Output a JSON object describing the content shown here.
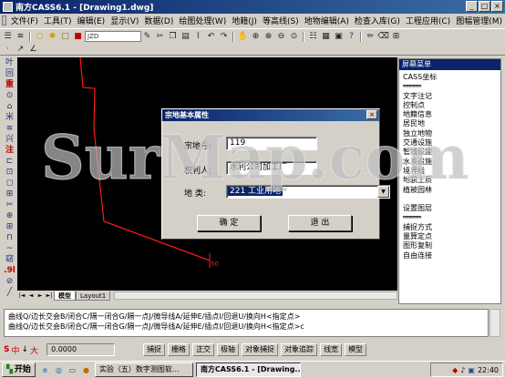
{
  "window": {
    "title": "南方CASS6.1 - [Drawing1.dwg]",
    "controls": [
      "_",
      "□",
      "×"
    ]
  },
  "menu": [
    "文件(F)",
    "工具(T)",
    "编辑(E)",
    "显示(V)",
    "数据(D)",
    "绘图处理(W)",
    "地籍(J)",
    "等高线(S)",
    "地物编辑(A)",
    "检查入库(G)",
    "工程应用(C)",
    "图幅管理(M)"
  ],
  "toolbar": {
    "layer_value": "JZD"
  },
  "left_tools": [
    "叶",
    "回",
    "重",
    "⊙",
    "⌂",
    "米",
    "≡",
    "兴",
    "注",
    "⊏",
    "⊡",
    "◻",
    "⊞",
    "✂",
    "⊕",
    "⊞",
    "⊓",
    "~",
    "窈",
    ".9l",
    "⊘",
    "╱"
  ],
  "screen_menu": {
    "title": "屏幕菜单",
    "items": [
      "CASS坐标",
      "═════",
      "文字注记",
      "控制点",
      "地籍信息",
      "居民地",
      "独立地物",
      "交通设施",
      "管线设施",
      "水系设施",
      "境界线",
      "地貌土质",
      "植被园林",
      "",
      "设置图层",
      "═════",
      "捕捉方式",
      "量算定点",
      "图形复制",
      "自由连接"
    ]
  },
  "canvas": {
    "vertex_label": "50"
  },
  "tabs": {
    "nav": [
      "|◄",
      "◄",
      "►",
      "►|"
    ],
    "items": [
      "模型",
      "Layout1"
    ]
  },
  "command": {
    "lines": [
      "曲线Q/边长交会B/闭合C/隔一闭合G/隔一点J/微导线A/延伸E/插点I/回退U/换向H<指定点>",
      "曲线Q/边长交会B/闭合C/隔一闭合G/隔一点J/微导线A/延伸E/插点I/回退U/换向H<指定点>c"
    ]
  },
  "status": {
    "ime": [
      "中",
      "↓",
      "大"
    ],
    "coords": "0.0000",
    "buttons": [
      "捕捉",
      "栅格",
      "正交",
      "极轴",
      "对象捕捉",
      "对象追踪",
      "线宽",
      "模型"
    ]
  },
  "taskbar": {
    "start": "开始",
    "tasks": [
      "实验（五）数字测图软...",
      "南方CASS6.1 - [Drawing..."
    ],
    "clock": "22:40"
  },
  "dialog": {
    "title": "宗地基本属性",
    "close": "×",
    "parcel_no_label": "宗地号:",
    "parcel_no_value": "119",
    "owner_label": "权利人:",
    "owner_value": "水利公司加工厂",
    "type_label": "地  类:",
    "type_value": "221 工业用地",
    "ok_label": "确  定",
    "cancel_label": "退  出"
  },
  "watermark": "SurMap.com"
}
